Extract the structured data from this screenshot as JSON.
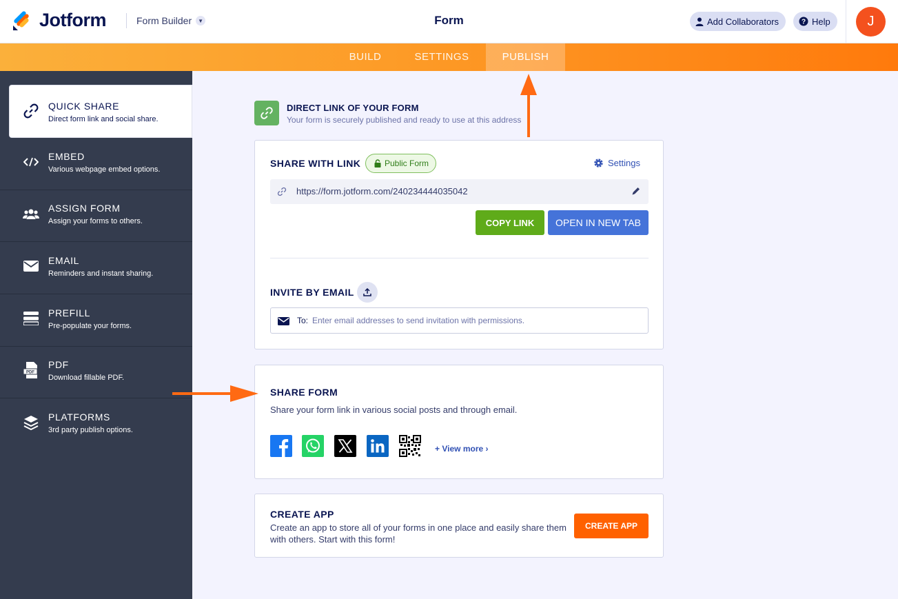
{
  "header": {
    "brand": "Jotform",
    "builder_label": "Form Builder",
    "title": "Form",
    "add_collaborators": "Add Collaborators",
    "help": "Help",
    "avatar_initial": "J"
  },
  "nav": {
    "tabs": [
      {
        "label": "BUILD",
        "active": false
      },
      {
        "label": "SETTINGS",
        "active": false
      },
      {
        "label": "PUBLISH",
        "active": true
      }
    ]
  },
  "sidebar": {
    "items": [
      {
        "title": "QUICK SHARE",
        "desc": "Direct form link and social share.",
        "icon": "link-icon",
        "active": true
      },
      {
        "title": "EMBED",
        "desc": "Various webpage embed options.",
        "icon": "code-icon"
      },
      {
        "title": "ASSIGN FORM",
        "desc": "Assign your forms to others.",
        "icon": "users-icon"
      },
      {
        "title": "EMAIL",
        "desc": "Reminders and instant sharing.",
        "icon": "envelope-icon"
      },
      {
        "title": "PREFILL",
        "desc": "Pre-populate your forms.",
        "icon": "prefill-icon"
      },
      {
        "title": "PDF",
        "desc": "Download fillable PDF.",
        "icon": "pdf-icon"
      },
      {
        "title": "PLATFORMS",
        "desc": "3rd party publish options.",
        "icon": "layers-icon"
      }
    ]
  },
  "direct_link": {
    "title": "DIRECT LINK OF YOUR FORM",
    "subtitle": "Your form is securely published and ready to use at this address"
  },
  "share_link": {
    "title": "SHARE WITH LINK",
    "badge": "Public Form",
    "settings": "Settings",
    "url": "https://form.jotform.com/240234444035042",
    "copy_button": "COPY LINK",
    "open_button": "OPEN IN NEW TAB"
  },
  "invite": {
    "title": "INVITE BY EMAIL",
    "to_label": "To:",
    "placeholder": "Enter email addresses to send invitation with permissions."
  },
  "share_form": {
    "title": "SHARE FORM",
    "desc": "Share your form link in various social posts and through email.",
    "socials": [
      "facebook-icon",
      "whatsapp-icon",
      "x-icon",
      "linkedin-icon",
      "qr-code-icon"
    ],
    "view_more": "View more"
  },
  "create_app": {
    "title": "CREATE APP",
    "desc": "Create an app to store all of your forms in one place and easily share them with others. Start with this form!",
    "button": "CREATE APP"
  },
  "colors": {
    "accent_orange": "#ff6100",
    "copy_green": "#5fab1a",
    "open_blue": "#4573d9",
    "sidebar_bg": "#343c4e",
    "annotation_arrow": "#ff6a13"
  }
}
